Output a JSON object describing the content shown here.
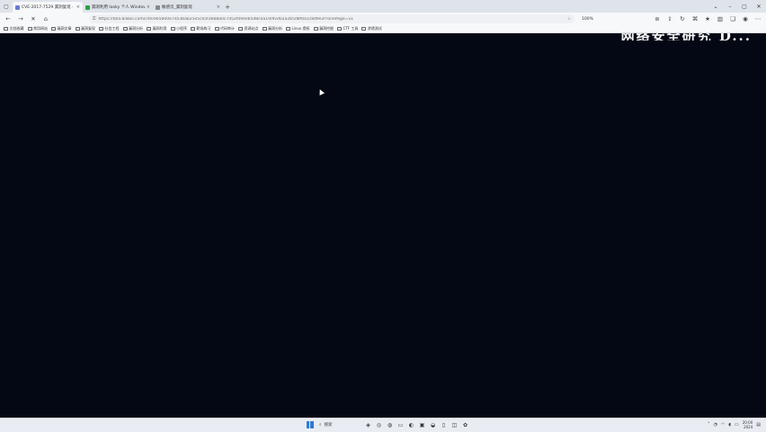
{
  "tabs": [
    {
      "title": "CVE-2017-7529 漏洞复现 · go",
      "active": true
    },
    {
      "title": "漏洞利用 looky 个人 Windows",
      "active": false
    },
    {
      "title": "敏感页_漏洞复现",
      "active": false
    }
  ],
  "address": {
    "url": "https://tola.bilibili.com/cdn/e65b00e7d53bab25e5ce5f36b8a0c7d52f09e0b5d8c0a19/9vd02a2b5d8f0a1c8d9e2f?onePage=v1"
  },
  "zoom": "100%",
  "bookmarks": [
    "文档收藏",
    "常用网站",
    "漏洞文章",
    "漏洞复现",
    "社会工程",
    "漏洞分析",
    "漏洞利用",
    "小程序",
    "靶场练习",
    "代码审计",
    "资源站点",
    "漏洞分析",
    "Linux 提权",
    "漏洞挖掘",
    "CTF 工具",
    "渗透测试"
  ],
  "banner": {
    "text": "网络安全研究 D..."
  },
  "taskbar": {
    "search_label": "搜索",
    "time": "20:00",
    "date": "2024"
  },
  "colors": {
    "page_bg": "#040814",
    "tab_bg": "#dfe3ea",
    "toolbar_bg": "#f7f8fa",
    "taskbar_bg": "#e9ecf2",
    "win_blue": "#2d7ad6"
  }
}
